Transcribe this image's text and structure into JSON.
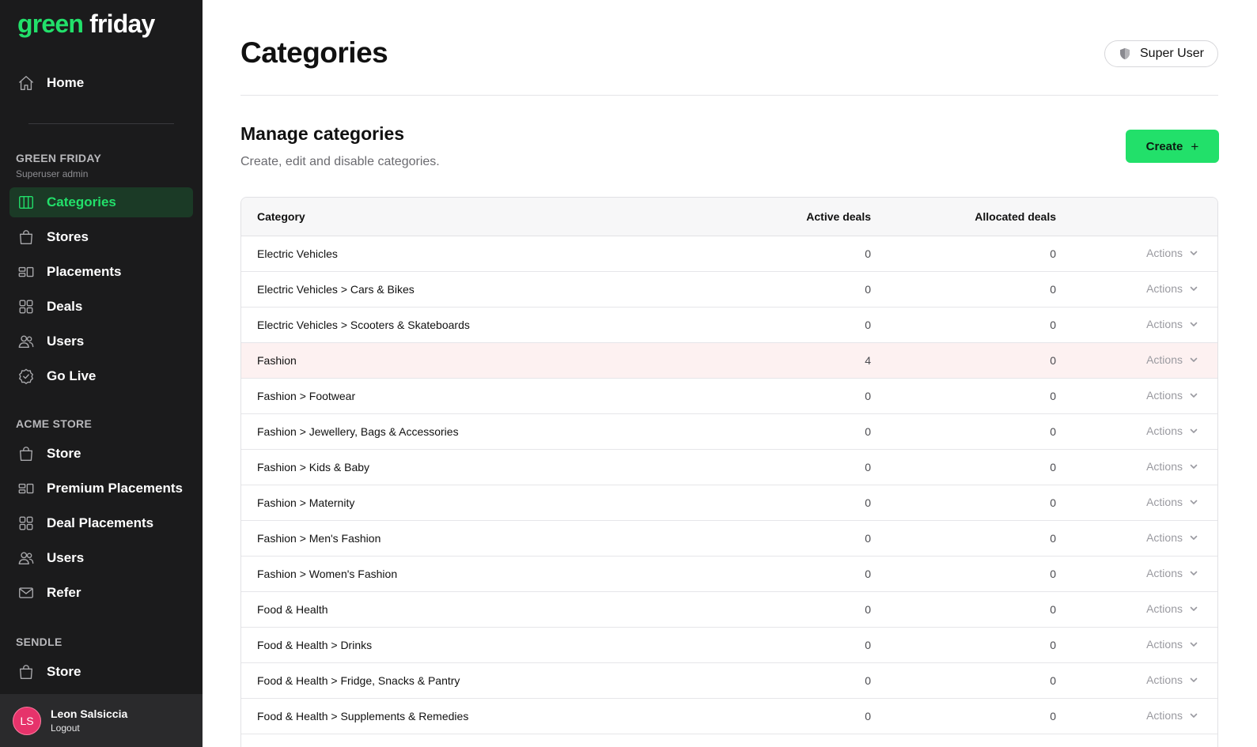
{
  "brand": {
    "part1": "green",
    "part2": "friday",
    "accent_color": "#22e06a"
  },
  "sidebar": {
    "home": {
      "label": "Home",
      "icon": "home-icon"
    },
    "section_green_friday": {
      "title": "GREEN FRIDAY",
      "subtitle": "Superuser admin",
      "items": [
        {
          "label": "Categories",
          "icon": "columns-icon",
          "active": true
        },
        {
          "label": "Stores",
          "icon": "shopping-bag-icon"
        },
        {
          "label": "Placements",
          "icon": "placements-icon"
        },
        {
          "label": "Deals",
          "icon": "grid-icon"
        },
        {
          "label": "Users",
          "icon": "users-icon"
        },
        {
          "label": "Go Live",
          "icon": "check-badge-icon"
        }
      ]
    },
    "section_acme": {
      "title": "ACME STORE",
      "items": [
        {
          "label": "Store",
          "icon": "shopping-bag-icon"
        },
        {
          "label": "Premium Placements",
          "icon": "placements-icon"
        },
        {
          "label": "Deal Placements",
          "icon": "grid-icon"
        },
        {
          "label": "Users",
          "icon": "users-icon"
        },
        {
          "label": "Refer",
          "icon": "envelope-icon"
        }
      ]
    },
    "section_sendle": {
      "title": "SENDLE",
      "items": [
        {
          "label": "Store",
          "icon": "shopping-bag-icon"
        }
      ]
    },
    "user": {
      "initials": "LS",
      "name": "Leon Salsiccia",
      "logout": "Logout",
      "avatar_color": "#e6336b"
    }
  },
  "header": {
    "title": "Categories",
    "role": {
      "label": "Super User",
      "icon": "shield-icon"
    }
  },
  "section": {
    "heading": "Manage categories",
    "description": "Create, edit and disable categories.",
    "create_label": "Create",
    "create_icon": "+"
  },
  "table": {
    "columns": {
      "category": "Category",
      "active": "Active deals",
      "allocated": "Allocated deals"
    },
    "actions_label": "Actions",
    "rows": [
      {
        "category": "Electric Vehicles",
        "active": "0",
        "allocated": "0"
      },
      {
        "category": "Electric Vehicles > Cars & Bikes",
        "active": "0",
        "allocated": "0"
      },
      {
        "category": "Electric Vehicles > Scooters & Skateboards",
        "active": "0",
        "allocated": "0"
      },
      {
        "category": "Fashion",
        "active": "4",
        "allocated": "0",
        "highlight": true
      },
      {
        "category": "Fashion > Footwear",
        "active": "0",
        "allocated": "0"
      },
      {
        "category": "Fashion > Jewellery, Bags & Accessories",
        "active": "0",
        "allocated": "0"
      },
      {
        "category": "Fashion > Kids & Baby",
        "active": "0",
        "allocated": "0"
      },
      {
        "category": "Fashion > Maternity",
        "active": "0",
        "allocated": "0"
      },
      {
        "category": "Fashion > Men's Fashion",
        "active": "0",
        "allocated": "0"
      },
      {
        "category": "Fashion > Women's Fashion",
        "active": "0",
        "allocated": "0"
      },
      {
        "category": "Food & Health",
        "active": "0",
        "allocated": "0"
      },
      {
        "category": "Food & Health > Drinks",
        "active": "0",
        "allocated": "0"
      },
      {
        "category": "Food & Health > Fridge, Snacks & Pantry",
        "active": "0",
        "allocated": "0"
      },
      {
        "category": "Food & Health > Supplements & Remedies",
        "active": "0",
        "allocated": "0"
      }
    ]
  }
}
